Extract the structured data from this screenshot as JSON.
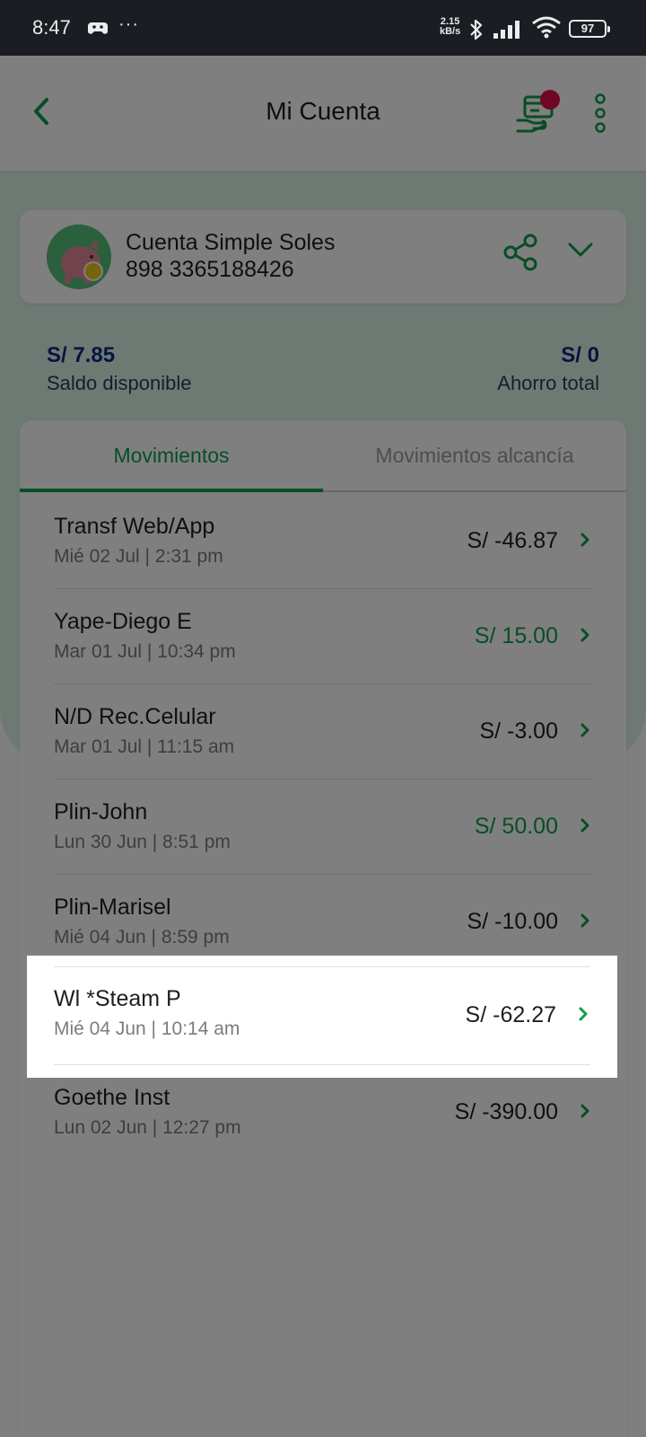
{
  "status_bar": {
    "time": "8:47",
    "more": "···",
    "speed_value": "2.15",
    "speed_unit": "kB/s",
    "battery": "97"
  },
  "header": {
    "title": "Mi Cuenta",
    "back_icon": "chevron-left-icon",
    "action_icon": "card-hand-icon",
    "menu_icon": "kebab-menu-icon"
  },
  "account": {
    "name": "Cuenta Simple Soles",
    "number": "898 3365188426",
    "share_icon": "share-icon",
    "expand_icon": "chevron-down-icon"
  },
  "balances": {
    "available_amount": "S/ 7.85",
    "available_label": "Saldo disponible",
    "savings_amount": "S/ 0",
    "savings_label": "Ahorro total"
  },
  "tabs": [
    {
      "label": "Movimientos",
      "active": true
    },
    {
      "label": "Movimientos alcancía",
      "active": false
    }
  ],
  "movements": [
    {
      "name": "Transf Web/App",
      "date": "Mié 02 Jul | 2:31 pm",
      "amount": "S/ -46.87",
      "positive": false
    },
    {
      "name": "Yape-Diego E",
      "date": "Mar 01 Jul | 10:34 pm",
      "amount": "S/ 15.00",
      "positive": true
    },
    {
      "name": "N/D Rec.Celular",
      "date": "Mar 01 Jul | 11:15 am",
      "amount": "S/ -3.00",
      "positive": false
    },
    {
      "name": "Plin-John",
      "date": "Lun 30 Jun | 8:51 pm",
      "amount": "S/ 50.00",
      "positive": true
    },
    {
      "name": "Plin-Marisel",
      "date": "Mié 04 Jun | 8:59 pm",
      "amount": "S/ -10.00",
      "positive": false
    },
    {
      "name": "Wl *Steam P",
      "date": "Mié 04 Jun | 10:14 am",
      "amount": "S/ -62.27",
      "positive": false
    },
    {
      "name": "Goethe Inst",
      "date": "Lun 02 Jun | 12:27 pm",
      "amount": "S/ -390.00",
      "positive": false
    }
  ],
  "highlighted_index": 5,
  "colors": {
    "brand_green": "#0f9d4a",
    "balance_blue": "#0f2a7a",
    "notification_red": "#e0104b"
  }
}
